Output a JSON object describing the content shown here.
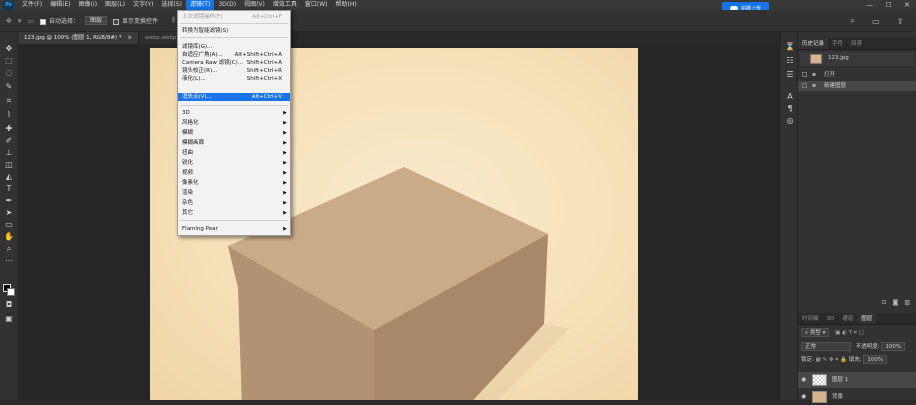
{
  "menubar": {
    "logo": "Ps",
    "items": [
      "文件(F)",
      "编辑(E)",
      "图像(I)",
      "图层(L)",
      "文字(Y)",
      "选择(S)",
      "滤镜(T)",
      "3D(D)",
      "视图(V)",
      "增效工具",
      "窗口(W)",
      "帮助(H)"
    ],
    "active_index": 6
  },
  "share_button": "拍摄上传",
  "window_controls": [
    "—",
    "☐",
    "✕"
  ],
  "options_bar": {
    "auto_select_label": "自动选择：",
    "auto_select_value": "图层",
    "show_transform_label": "显示变换控件"
  },
  "doc_tabs": [
    {
      "label": "123.jpg @ 100% (图层 1, RGB/8#) *",
      "close": "×",
      "active": true
    },
    {
      "label": "webp.webp.jpg",
      "active": false
    }
  ],
  "filter_menu": {
    "items": [
      {
        "label": "上次滤镜操作(F)",
        "shortcut": "Alt+Ctrl+F",
        "disabled": true
      },
      {
        "label": "转换为智能滤镜(S)"
      },
      {
        "label": "滤镜库(G)..."
      },
      {
        "label": "自适应广角(A)...",
        "shortcut": "Alt+Shift+Ctrl+A"
      },
      {
        "label": "Camera Raw 滤镜(C)...",
        "shortcut": "Shift+Ctrl+A"
      },
      {
        "label": "镜头校正(R)...",
        "shortcut": "Shift+Ctrl+R"
      },
      {
        "label": "液化(L)...",
        "shortcut": "Shift+Ctrl+X"
      },
      {
        "label": "消失点(V)...",
        "shortcut": "Alt+Ctrl+V",
        "highlighted": true
      },
      {
        "label": "3D",
        "submenu": true
      },
      {
        "label": "风格化",
        "submenu": true
      },
      {
        "label": "模糊",
        "submenu": true
      },
      {
        "label": "模糊画廊",
        "submenu": true
      },
      {
        "label": "扭曲",
        "submenu": true
      },
      {
        "label": "锐化",
        "submenu": true
      },
      {
        "label": "视频",
        "submenu": true
      },
      {
        "label": "像素化",
        "submenu": true
      },
      {
        "label": "渲染",
        "submenu": true
      },
      {
        "label": "杂色",
        "submenu": true
      },
      {
        "label": "其它",
        "submenu": true
      },
      {
        "label": "Flaming Pear",
        "submenu": true
      }
    ]
  },
  "history_panel": {
    "tabs": [
      "历史记录",
      "字符",
      "段落"
    ],
    "snapshot": "123.jpg",
    "steps": [
      "打开",
      "新建图层"
    ]
  },
  "layers_panel": {
    "tabs": [
      "时间轴",
      "3D",
      "通道",
      "图层"
    ],
    "filter_label": "类型",
    "blend_mode": "正常",
    "opacity_label": "不透明度:",
    "opacity_value": "100%",
    "lock_label": "锁定:",
    "fill_label": "填充:",
    "fill_value": "100%",
    "layers": [
      {
        "name": "图层 1",
        "selected": true
      },
      {
        "name": "背景",
        "selected": false
      }
    ]
  },
  "colors": {
    "accent": "#1473e6",
    "box_light": "#c9ab87",
    "box_side": "#b19273",
    "box_front": "#a88868",
    "canvas_bg": "#f7e4c1"
  }
}
